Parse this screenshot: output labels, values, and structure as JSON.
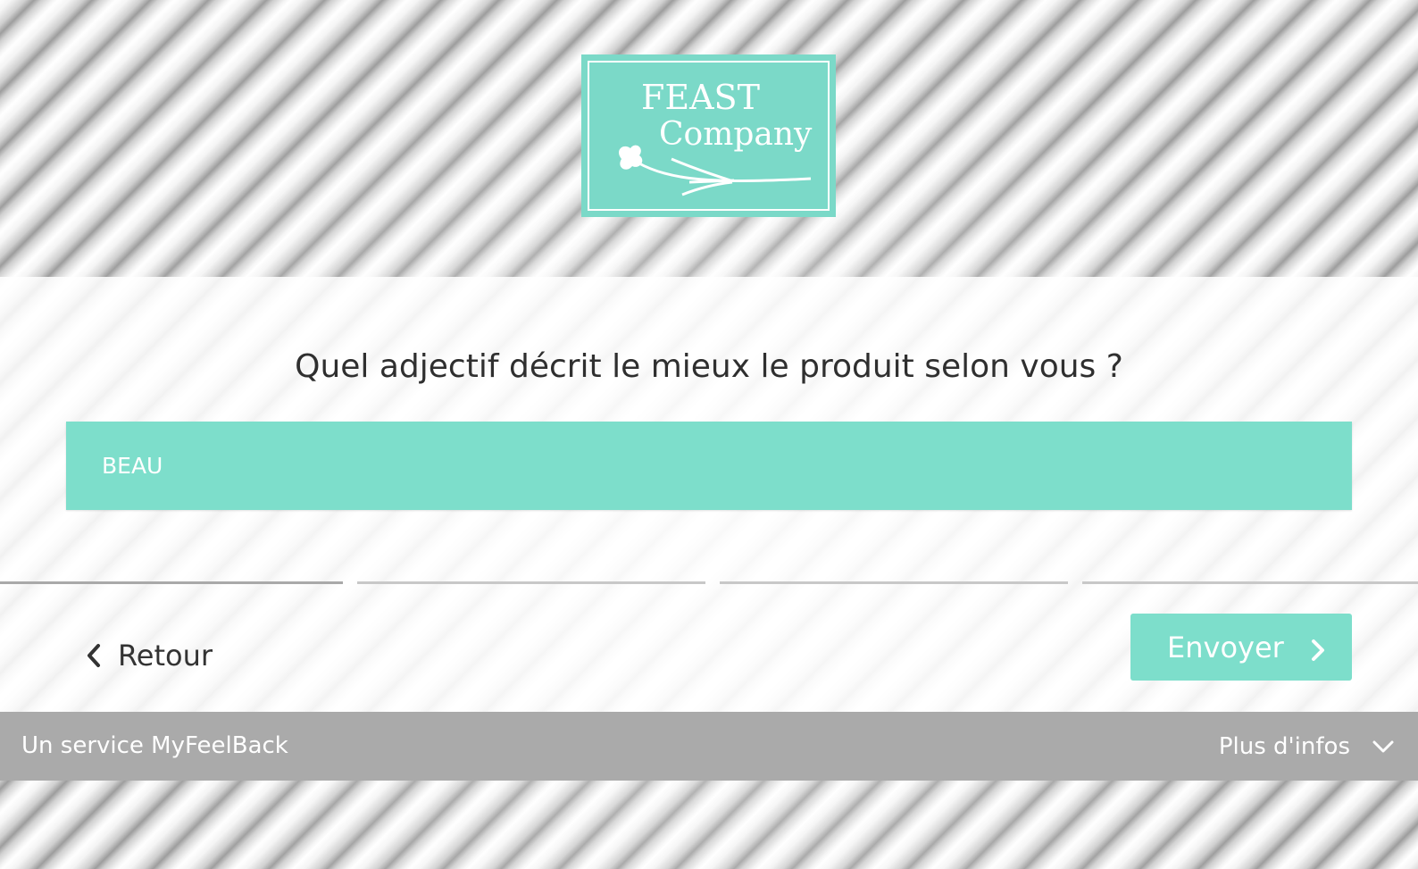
{
  "logo": {
    "line1": "FEAST",
    "line2": "Company",
    "color": "#7bd9c8"
  },
  "survey": {
    "question": "Quel adjectif décrit le mieux le produit selon vous ?",
    "answer": "BEAU",
    "progress": {
      "total_steps": 4,
      "completed_steps": 1
    }
  },
  "nav": {
    "back_label": "Retour",
    "send_label": "Envoyer",
    "back_icon": "chevron-left-icon",
    "send_icon": "chevron-right-icon"
  },
  "footer": {
    "service_text": "Un service MyFeelBack",
    "more_info_label": "Plus d'infos",
    "more_info_icon": "chevron-down-icon"
  },
  "colors": {
    "accent": "#7ddecb",
    "footer_bg": "#aaaaaa",
    "text": "#2f2f2f"
  }
}
